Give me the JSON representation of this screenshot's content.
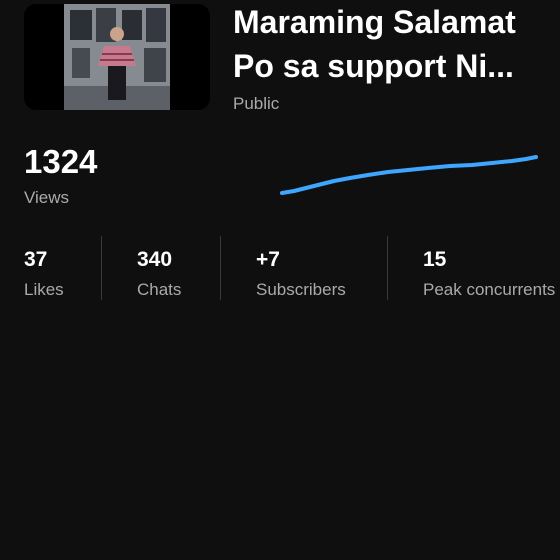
{
  "video": {
    "title_line1": "Maraming Salamat",
    "title_line2": "Po sa support Ni...",
    "visibility": "Public",
    "thumbnail": "video-thumbnail"
  },
  "views": {
    "value": "1324",
    "label": "Views",
    "trend_color": "#3ea6ff"
  },
  "stats": [
    {
      "value": "37",
      "label": "Likes"
    },
    {
      "value": "340",
      "label": "Chats"
    },
    {
      "value": "+7",
      "label": "Subscribers"
    },
    {
      "value": "15",
      "label": "Peak concurrents"
    }
  ],
  "colors": {
    "background": "#0f0f0f",
    "primary_text": "#ffffff",
    "secondary_text": "#aaaaaa",
    "accent": "#3ea6ff"
  }
}
